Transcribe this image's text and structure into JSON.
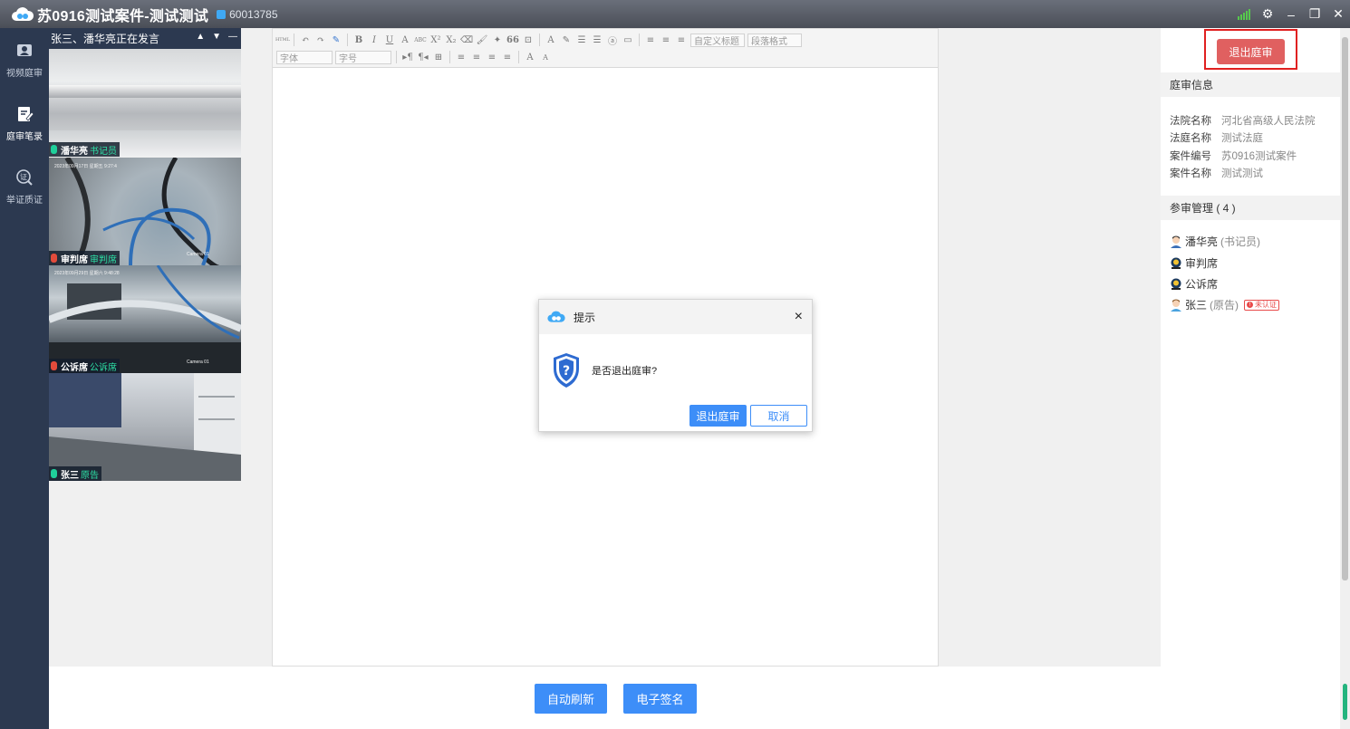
{
  "window": {
    "title": "苏0916测试案件-测试测试",
    "room_id": "60013785"
  },
  "nav": {
    "items": [
      {
        "label": "视频庭审",
        "icon": "video-icon"
      },
      {
        "label": "庭审笔录",
        "icon": "notes-icon"
      },
      {
        "label": "举证质证",
        "icon": "evidence-icon"
      }
    ]
  },
  "video": {
    "speaking_text": "张三、潘华亮正在发言",
    "tiles": [
      {
        "name": "潘华亮",
        "role": "书记员",
        "mic": "green"
      },
      {
        "name": "审判席",
        "role": "审判席",
        "mic": "red",
        "overlay_text": "2023年09月17日 星期五 9:27:4",
        "camera_text": "Camera 01"
      },
      {
        "name": "公诉席",
        "role": "公诉席",
        "mic": "red",
        "overlay_text": "2023年09月29日 星期六 9:48:28",
        "camera_text": "Camera 01"
      },
      {
        "name": "张三",
        "role": "原告",
        "mic": "green"
      }
    ]
  },
  "editor": {
    "toolbar_row1": [
      "HTML",
      "↶",
      "↷",
      "✎",
      "B",
      "I",
      "U",
      "A",
      "ABC",
      "X²",
      "X₂",
      "⌫",
      "🖌",
      "✦",
      "66",
      "⊡",
      "A",
      "✎",
      "☰",
      "☰",
      "ⓐ",
      "▭",
      "≡",
      "≡",
      "≡"
    ],
    "font_placeholder": "字体",
    "size_placeholder": "字号",
    "custom_title_placeholder": "自定义标题",
    "paragraph_placeholder": "段落格式",
    "toolbar_row2": [
      "▸¶",
      "¶◂",
      "⊞",
      "≡",
      "≡",
      "≡",
      "≡",
      "A",
      "A"
    ]
  },
  "bottom": {
    "refresh_button": "自动刷新",
    "sign_button": "电子签名"
  },
  "info_panel": {
    "exit_button": "退出庭审",
    "court_section_title": "庭审信息",
    "court_info": [
      {
        "key": "法院名称",
        "value": "河北省高级人民法院"
      },
      {
        "key": "法庭名称",
        "value": "测试法庭"
      },
      {
        "key": "案件编号",
        "value": "苏0916测试案件"
      },
      {
        "key": "案件名称",
        "value": "测试测试"
      }
    ],
    "participants_title": "参审管理 ( 4 )",
    "participants": [
      {
        "name": "潘华亮",
        "role": "(书记员)",
        "avatar": "male-avatar-icon",
        "badge": ""
      },
      {
        "name": "审判席",
        "role": "",
        "avatar": "seat-avatar-icon",
        "badge": ""
      },
      {
        "name": "公诉席",
        "role": "",
        "avatar": "seat-avatar-icon",
        "badge": ""
      },
      {
        "name": "张三",
        "role": "(原告)",
        "avatar": "male-avatar-icon",
        "badge": "未认证"
      }
    ]
  },
  "dialog": {
    "title": "提示",
    "message": "是否退出庭审?",
    "confirm_button": "退出庭审",
    "cancel_button": "取消",
    "close_icon": "×"
  },
  "colors": {
    "title_bar": "#4f545e",
    "nav_bg": "#2c3950",
    "primary": "#3d8ef8",
    "exit_red": "#e06060",
    "role_green": "#2de0a6"
  }
}
